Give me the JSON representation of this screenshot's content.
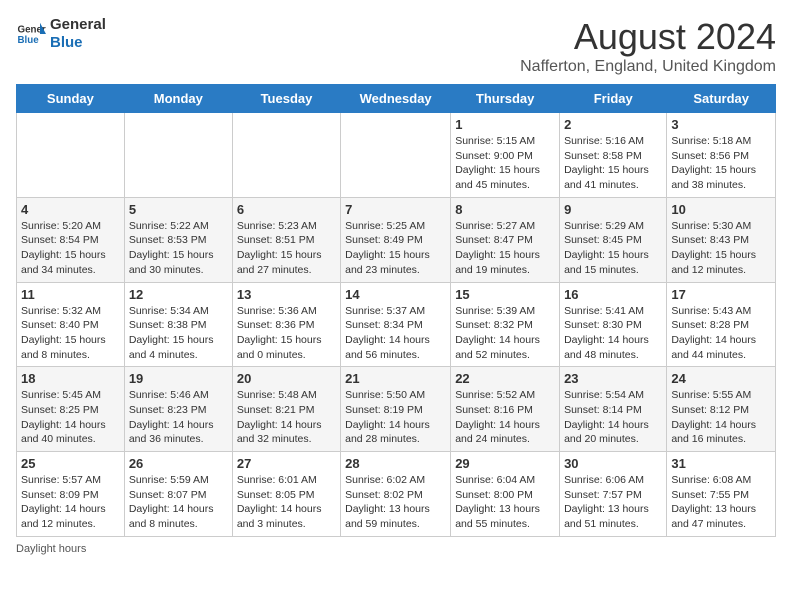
{
  "logo": {
    "text_general": "General",
    "text_blue": "Blue"
  },
  "title": "August 2024",
  "subtitle": "Nafferton, England, United Kingdom",
  "days_of_week": [
    "Sunday",
    "Monday",
    "Tuesday",
    "Wednesday",
    "Thursday",
    "Friday",
    "Saturday"
  ],
  "weeks": [
    [
      {
        "day": "",
        "detail": ""
      },
      {
        "day": "",
        "detail": ""
      },
      {
        "day": "",
        "detail": ""
      },
      {
        "day": "",
        "detail": ""
      },
      {
        "day": "1",
        "detail": "Sunrise: 5:15 AM\nSunset: 9:00 PM\nDaylight: 15 hours and 45 minutes."
      },
      {
        "day": "2",
        "detail": "Sunrise: 5:16 AM\nSunset: 8:58 PM\nDaylight: 15 hours and 41 minutes."
      },
      {
        "day": "3",
        "detail": "Sunrise: 5:18 AM\nSunset: 8:56 PM\nDaylight: 15 hours and 38 minutes."
      }
    ],
    [
      {
        "day": "4",
        "detail": "Sunrise: 5:20 AM\nSunset: 8:54 PM\nDaylight: 15 hours and 34 minutes."
      },
      {
        "day": "5",
        "detail": "Sunrise: 5:22 AM\nSunset: 8:53 PM\nDaylight: 15 hours and 30 minutes."
      },
      {
        "day": "6",
        "detail": "Sunrise: 5:23 AM\nSunset: 8:51 PM\nDaylight: 15 hours and 27 minutes."
      },
      {
        "day": "7",
        "detail": "Sunrise: 5:25 AM\nSunset: 8:49 PM\nDaylight: 15 hours and 23 minutes."
      },
      {
        "day": "8",
        "detail": "Sunrise: 5:27 AM\nSunset: 8:47 PM\nDaylight: 15 hours and 19 minutes."
      },
      {
        "day": "9",
        "detail": "Sunrise: 5:29 AM\nSunset: 8:45 PM\nDaylight: 15 hours and 15 minutes."
      },
      {
        "day": "10",
        "detail": "Sunrise: 5:30 AM\nSunset: 8:43 PM\nDaylight: 15 hours and 12 minutes."
      }
    ],
    [
      {
        "day": "11",
        "detail": "Sunrise: 5:32 AM\nSunset: 8:40 PM\nDaylight: 15 hours and 8 minutes."
      },
      {
        "day": "12",
        "detail": "Sunrise: 5:34 AM\nSunset: 8:38 PM\nDaylight: 15 hours and 4 minutes."
      },
      {
        "day": "13",
        "detail": "Sunrise: 5:36 AM\nSunset: 8:36 PM\nDaylight: 15 hours and 0 minutes."
      },
      {
        "day": "14",
        "detail": "Sunrise: 5:37 AM\nSunset: 8:34 PM\nDaylight: 14 hours and 56 minutes."
      },
      {
        "day": "15",
        "detail": "Sunrise: 5:39 AM\nSunset: 8:32 PM\nDaylight: 14 hours and 52 minutes."
      },
      {
        "day": "16",
        "detail": "Sunrise: 5:41 AM\nSunset: 8:30 PM\nDaylight: 14 hours and 48 minutes."
      },
      {
        "day": "17",
        "detail": "Sunrise: 5:43 AM\nSunset: 8:28 PM\nDaylight: 14 hours and 44 minutes."
      }
    ],
    [
      {
        "day": "18",
        "detail": "Sunrise: 5:45 AM\nSunset: 8:25 PM\nDaylight: 14 hours and 40 minutes."
      },
      {
        "day": "19",
        "detail": "Sunrise: 5:46 AM\nSunset: 8:23 PM\nDaylight: 14 hours and 36 minutes."
      },
      {
        "day": "20",
        "detail": "Sunrise: 5:48 AM\nSunset: 8:21 PM\nDaylight: 14 hours and 32 minutes."
      },
      {
        "day": "21",
        "detail": "Sunrise: 5:50 AM\nSunset: 8:19 PM\nDaylight: 14 hours and 28 minutes."
      },
      {
        "day": "22",
        "detail": "Sunrise: 5:52 AM\nSunset: 8:16 PM\nDaylight: 14 hours and 24 minutes."
      },
      {
        "day": "23",
        "detail": "Sunrise: 5:54 AM\nSunset: 8:14 PM\nDaylight: 14 hours and 20 minutes."
      },
      {
        "day": "24",
        "detail": "Sunrise: 5:55 AM\nSunset: 8:12 PM\nDaylight: 14 hours and 16 minutes."
      }
    ],
    [
      {
        "day": "25",
        "detail": "Sunrise: 5:57 AM\nSunset: 8:09 PM\nDaylight: 14 hours and 12 minutes."
      },
      {
        "day": "26",
        "detail": "Sunrise: 5:59 AM\nSunset: 8:07 PM\nDaylight: 14 hours and 8 minutes."
      },
      {
        "day": "27",
        "detail": "Sunrise: 6:01 AM\nSunset: 8:05 PM\nDaylight: 14 hours and 3 minutes."
      },
      {
        "day": "28",
        "detail": "Sunrise: 6:02 AM\nSunset: 8:02 PM\nDaylight: 13 hours and 59 minutes."
      },
      {
        "day": "29",
        "detail": "Sunrise: 6:04 AM\nSunset: 8:00 PM\nDaylight: 13 hours and 55 minutes."
      },
      {
        "day": "30",
        "detail": "Sunrise: 6:06 AM\nSunset: 7:57 PM\nDaylight: 13 hours and 51 minutes."
      },
      {
        "day": "31",
        "detail": "Sunrise: 6:08 AM\nSunset: 7:55 PM\nDaylight: 13 hours and 47 minutes."
      }
    ]
  ],
  "footer": "Daylight hours"
}
